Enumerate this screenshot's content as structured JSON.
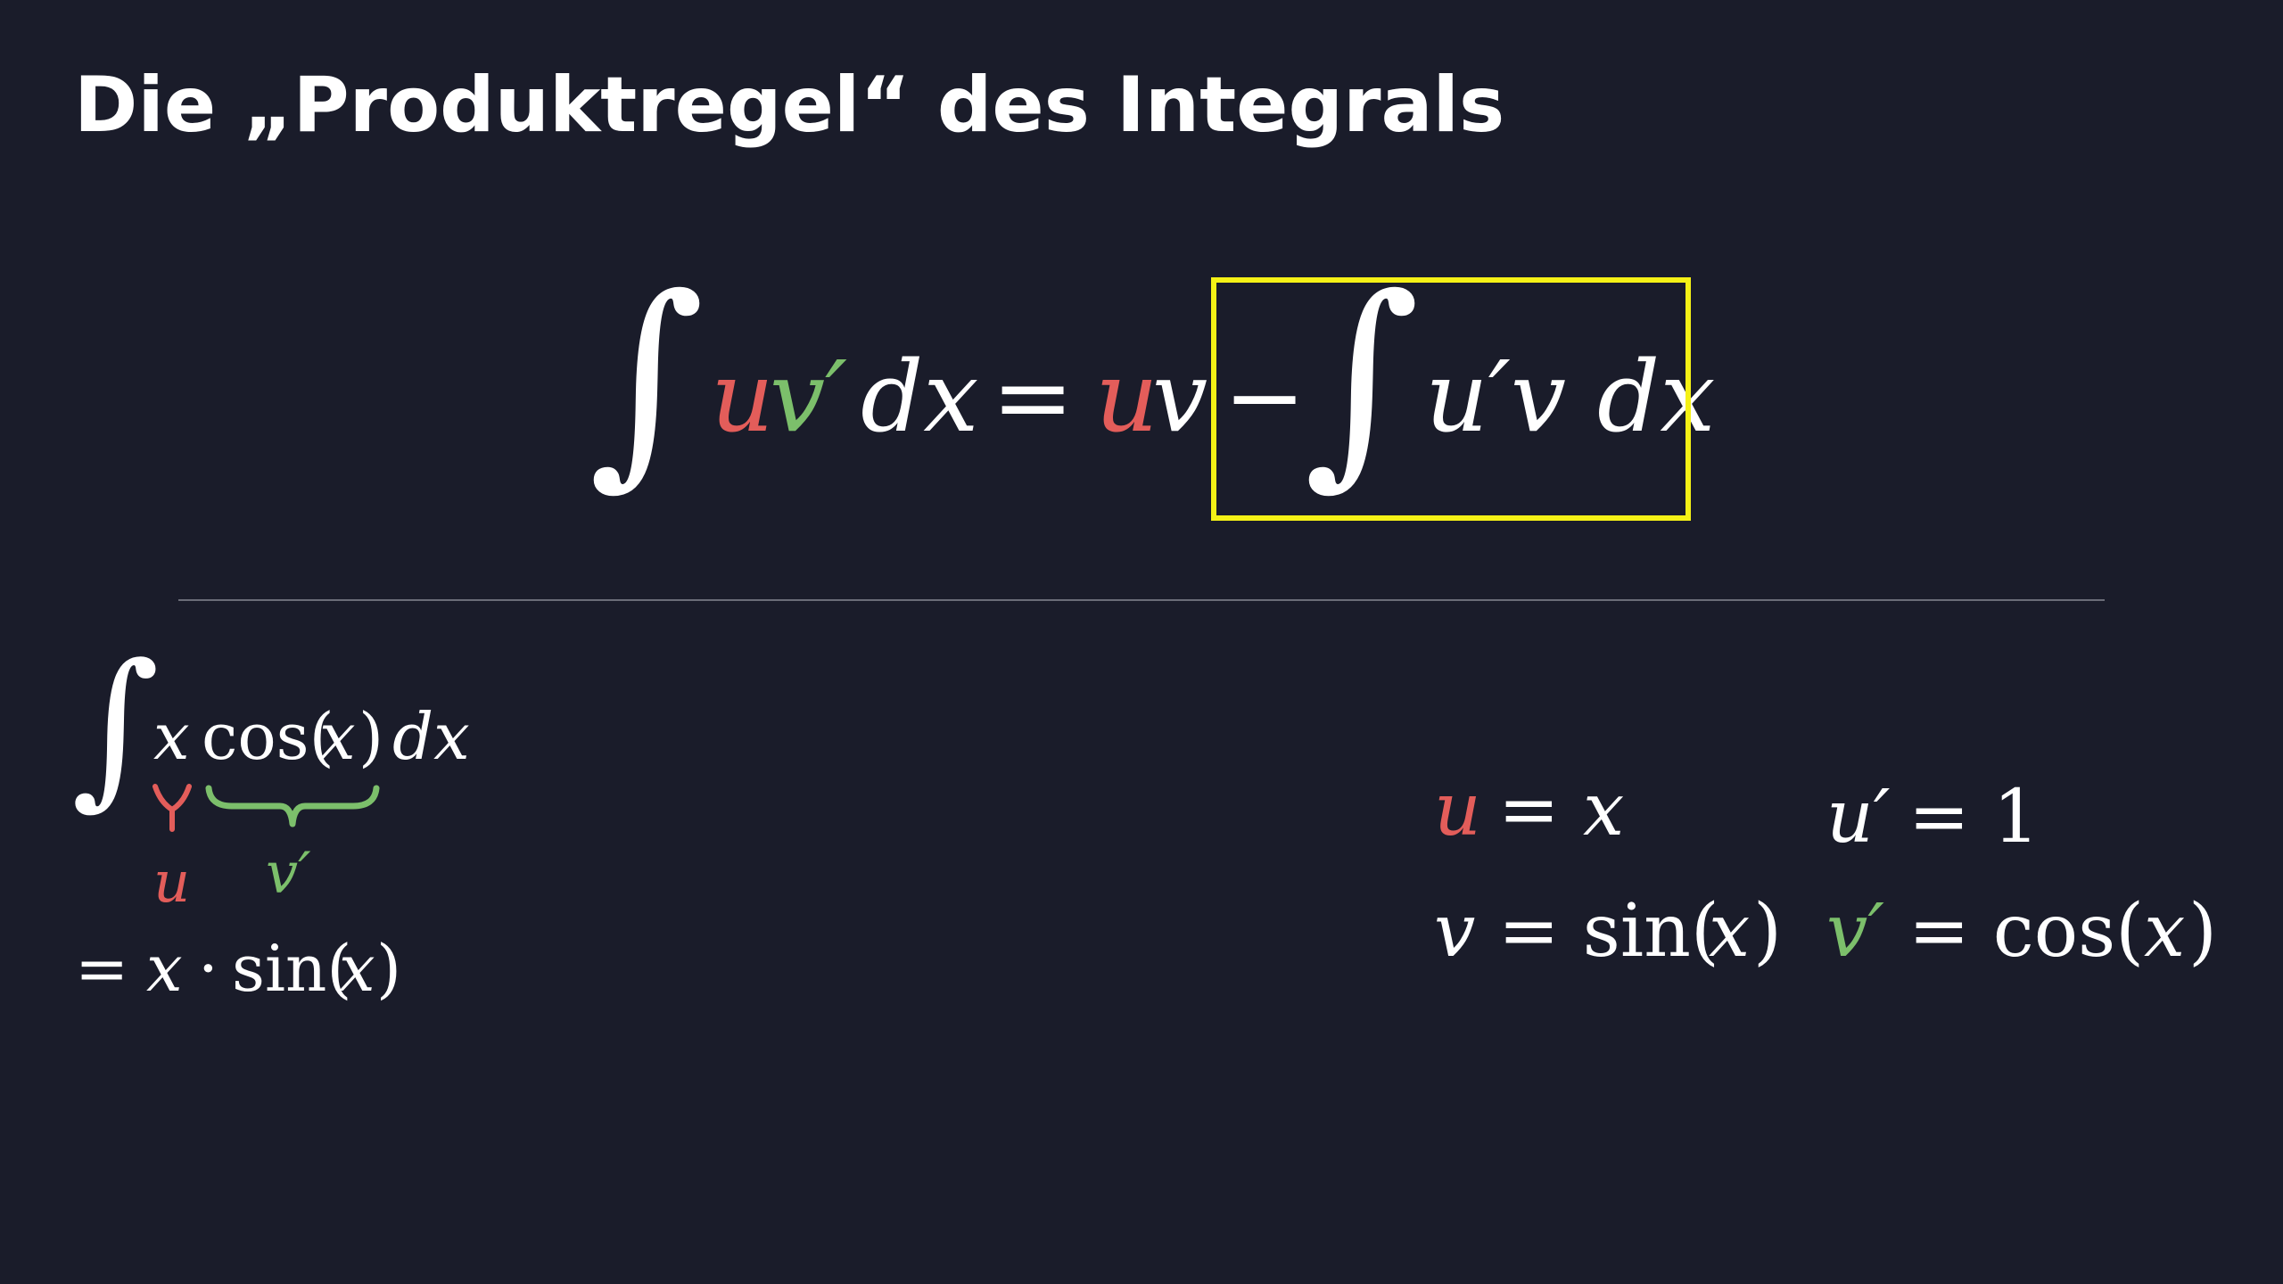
{
  "title": "Die „Produktregel“ des Integrals",
  "colors": {
    "background": "#1a1c2a",
    "u": "#e35d5a",
    "v_prime": "#7cbf6b",
    "highlight_box": "#f5f116",
    "divider": "#6b6d78",
    "text": "#ffffff"
  },
  "formula": {
    "integral": "∫",
    "lhs_u": "u",
    "lhs_vprime": "v′",
    "lhs_dx": "dx",
    "equals": "=",
    "rhs_u": "u",
    "rhs_v": "v",
    "minus": "−",
    "integral2": "∫",
    "rhs_integrand": "u′v dx"
  },
  "example": {
    "integral": "∫",
    "x": "x",
    "cos": "cos(",
    "cos_arg": "x",
    "cos_close": ")",
    "dx": "dx",
    "u_label": "u",
    "vprime_label": "v′",
    "result_eq": "=",
    "result_x": "x",
    "result_dot": "·",
    "result_sin": "sin(",
    "result_arg": "x",
    "result_close": ")"
  },
  "assignments": {
    "u_var": "u",
    "u_eq": "= ",
    "u_val": "x",
    "uprime": "u′",
    "uprime_eq": "= 1",
    "v_var": "v",
    "v_eq": "= sin(",
    "v_arg": "x",
    "v_close": ")",
    "vprime_var": "v′",
    "vprime_eq": "= cos(",
    "vprime_arg": "x",
    "vprime_close": ")"
  }
}
